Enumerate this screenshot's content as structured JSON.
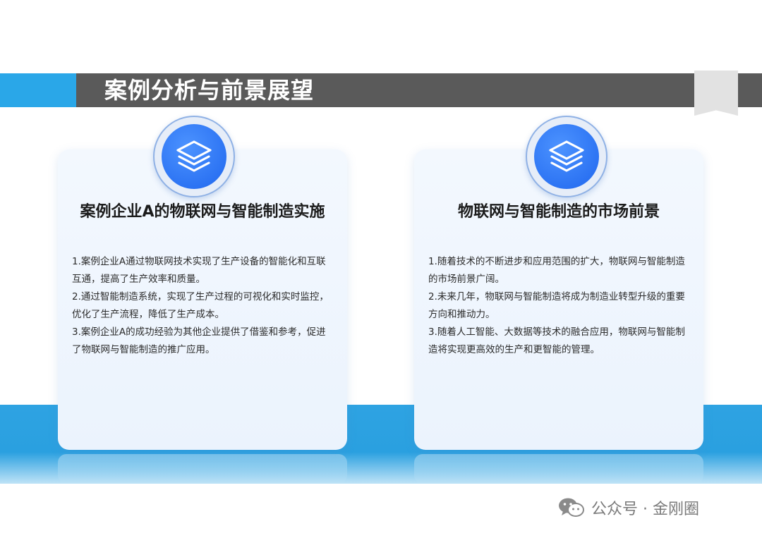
{
  "header": {
    "title": "案例分析与前景展望"
  },
  "cards": [
    {
      "title": "案例企业A的物联网与智能制造实施",
      "icon": "layers-icon",
      "paragraphs": [
        "1.案例企业A通过物联网技术实现了生产设备的智能化和互联互通，提高了生产效率和质量。",
        "2.通过智能制造系统，实现了生产过程的可视化和实时监控，优化了生产流程，降低了生产成本。",
        "3.案例企业A的成功经验为其他企业提供了借鉴和参考，促进了物联网与智能制造的推广应用。"
      ]
    },
    {
      "title": "物联网与智能制造的市场前景",
      "icon": "layers-icon",
      "paragraphs": [
        "1.随着技术的不断进步和应用范围的扩大，物联网与智能制造的市场前景广阔。",
        "2.未来几年，物联网与智能制造将成为制造业转型升级的重要方向和推动力。",
        "3.随着人工智能、大数据等技术的融合应用，物联网与智能制造将实现更高效的生产和更智能的管理。"
      ]
    }
  ],
  "footer": {
    "text": "公众号 · 金刚圈",
    "icon": "wechat-icon"
  },
  "colors": {
    "accent_blue": "#2aa7e8",
    "title_bar": "#5a5a5a",
    "icon_blue": "#1f66ee"
  }
}
